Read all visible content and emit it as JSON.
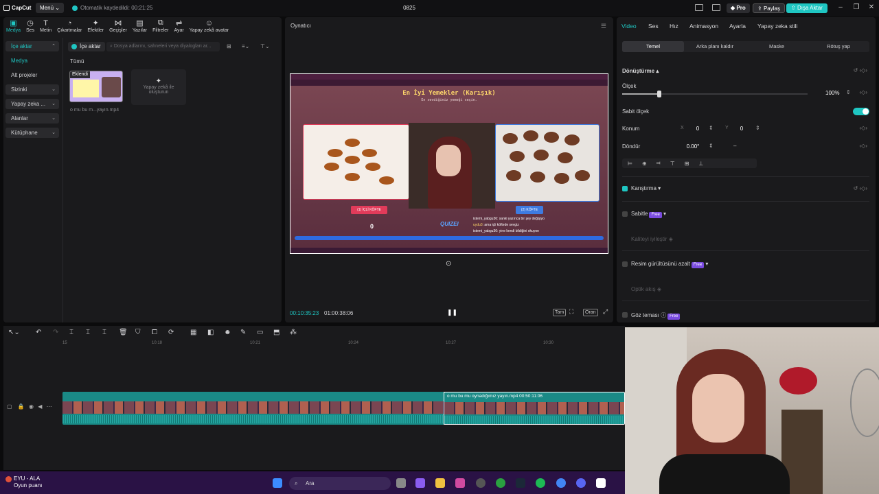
{
  "titlebar": {
    "app_name": "CapCut",
    "menu_label": "Menü",
    "autosave_text": "Otomatik kaydedildi: 00:21:25",
    "project_title": "0825",
    "pro_label": "Pro",
    "share_label": "Paylaş",
    "export_label": "Dışa Aktar"
  },
  "toolbar": {
    "tools": [
      {
        "label": "Medya",
        "icon": "media-icon"
      },
      {
        "label": "Ses",
        "icon": "audio-icon"
      },
      {
        "label": "Metin",
        "icon": "text-icon"
      },
      {
        "label": "Çıkartmalar",
        "icon": "sticker-icon"
      },
      {
        "label": "Efektler",
        "icon": "effects-icon"
      },
      {
        "label": "Geçişler",
        "icon": "transition-icon"
      },
      {
        "label": "Yazılar",
        "icon": "captions-icon"
      },
      {
        "label": "Filtreler",
        "icon": "filter-icon"
      },
      {
        "label": "Ayar",
        "icon": "adjust-icon"
      },
      {
        "label": "Yapay zekâ avatar",
        "icon": "ai-avatar-icon"
      }
    ]
  },
  "leftnav": {
    "import": "İçe aktar",
    "media": "Medya",
    "subprojects": "Alt projeler",
    "yours": "Sizinki",
    "ai": "Yapay zeka ...",
    "spaces": "Alanlar",
    "library": "Kütüphane"
  },
  "media": {
    "import_button": "İçe aktar",
    "search_placeholder": "Dosya adlarını, sahneleri veya diyalogları ar...",
    "all_label": "Tümü",
    "clip_badge": "Eklendi",
    "clip_name": "o mu bu m...yayın.mp4",
    "ai_card_line1": "Yapay zekâ ile",
    "ai_card_line2": "oluşturun"
  },
  "player": {
    "title": "Oynatıcı",
    "current_time": "00:10:35:23",
    "total_time": "01:00:38:06",
    "full_label": "Tam",
    "ratio_label": "Oran",
    "video": {
      "game_title": "En İyi Yemekler (Karışık)",
      "game_subtitle": "En sevdiğiniz yemeği seçin.",
      "choice_a": "(1) İÇLİ KÖFTE",
      "choice_b": "(2) KÖFTE",
      "score": "0",
      "logo": "QUIZEI",
      "chat": [
        {
          "user": "istemi_yabgu36",
          "text": ": sanki yazınca bir şey değişiyo"
        },
        {
          "user": "uydu3",
          "text": ": ama içli köftede sevgiz"
        },
        {
          "user": "istemi_yabgu36",
          "text": ": yine kendi bildiğini okuyon"
        }
      ]
    }
  },
  "inspector": {
    "tabs": [
      "Video",
      "Ses",
      "Hız",
      "Animasyon",
      "Ayarla",
      "Yapay zeka stili"
    ],
    "subtabs": [
      "Temel",
      "Arka planı kaldır",
      "Maske",
      "Rötuş yap"
    ],
    "transform_label": "Dönüştürme",
    "scale_label": "Ölçek",
    "scale_value": "100%",
    "scale_fraction": 0.2,
    "uniform_scale_label": "Sabit ölçek",
    "position_label": "Konum",
    "pos_x_label": "X",
    "pos_x": "0",
    "pos_y_label": "Y",
    "pos_y": "0",
    "rotate_label": "Döndür",
    "rotate_value": "0.00°",
    "blend_label": "Karıştırma",
    "stabilize_label": "Sabitle",
    "free_badge": "Free",
    "quality_label": "Kaliteyi iyileştir",
    "denoise_label": "Resim gürültüsünü azalt",
    "optical_label": "Optik akış",
    "eye_contact_label": "Göz teması"
  },
  "timeline": {
    "ruler_ticks": [
      "15",
      "10:18",
      "10:21",
      "10:24",
      "10:27",
      "10:30"
    ],
    "clip2_label": "o mu bu mu oynadığımız yayın.mp4   00:50:11:06"
  },
  "taskbar": {
    "user_name": "EYU - ALA",
    "user_sub": "Oyun puanı",
    "search_label": "Ara"
  },
  "colors": {
    "accent": "#1fc6c2",
    "free_badge": "#7a4be0"
  }
}
